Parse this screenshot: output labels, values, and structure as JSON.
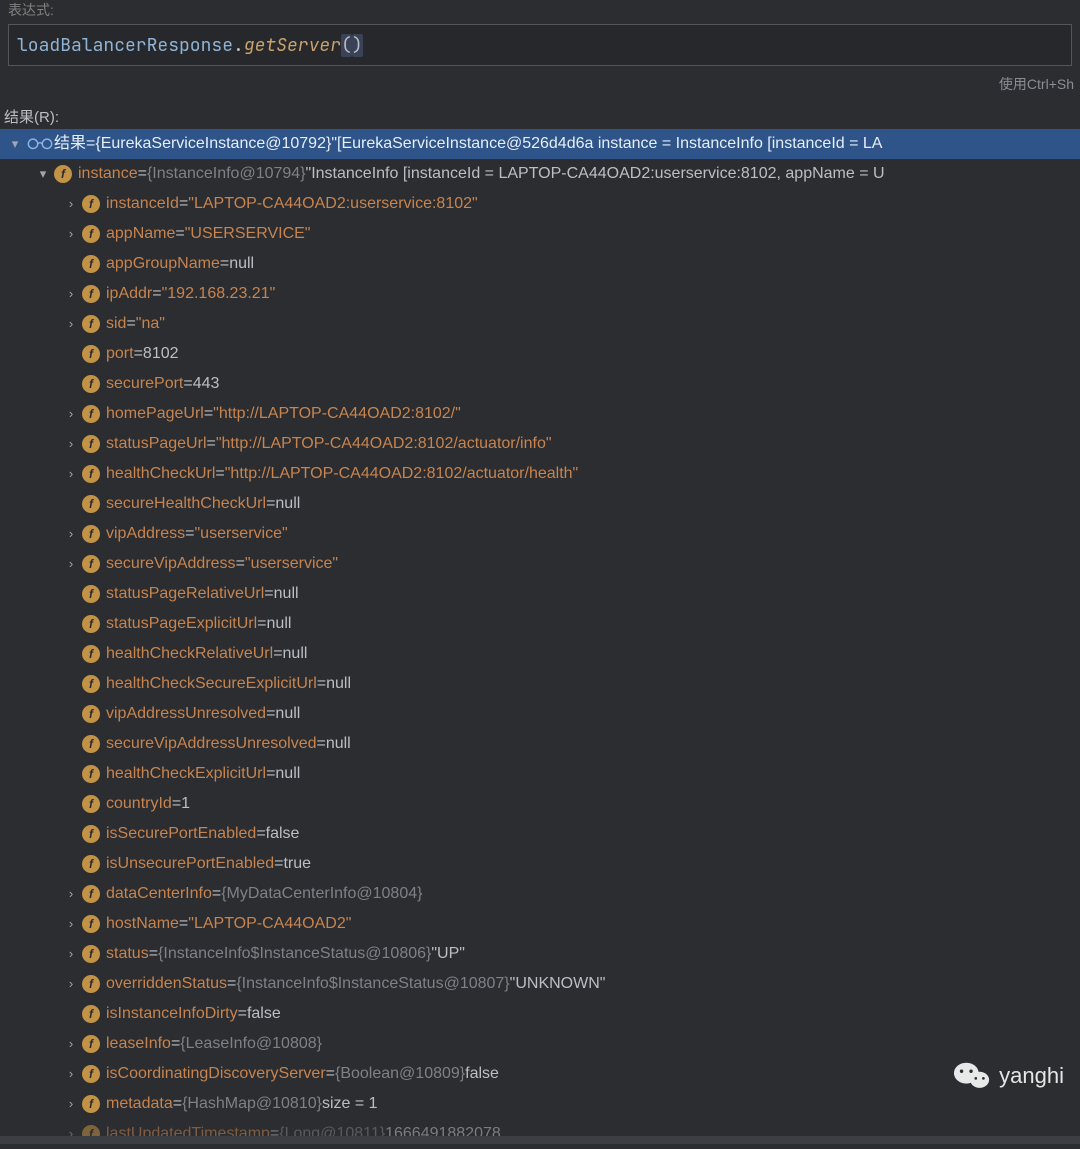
{
  "topLabel": "表达式:",
  "expression": {
    "var": "loadBalancerResponse",
    "dot": ".",
    "method": "getServer",
    "lp": "(",
    "rp": ")"
  },
  "hint": "使用Ctrl+Sh",
  "resultsLabel": "结果(R):",
  "root": {
    "label": "结果",
    "eq": " = ",
    "type": "{EurekaServiceInstance@10792}",
    "desc": " \"[EurekaServiceInstance@526d4d6a instance = InstanceInfo [instanceId = LA"
  },
  "instance": {
    "name": "instance",
    "eq": " = ",
    "type": "{InstanceInfo@10794}",
    "desc": " \"InstanceInfo [instanceId = LAPTOP-CA44OAD2:userservice:8102, appName = U"
  },
  "fields": [
    {
      "arrow": true,
      "name": "instanceId",
      "eq": " = ",
      "value": "\"LAPTOP-CA44OAD2:userservice:8102\"",
      "cls": "str"
    },
    {
      "arrow": true,
      "name": "appName",
      "eq": " = ",
      "value": "\"USERSERVICE\"",
      "cls": "str"
    },
    {
      "arrow": false,
      "name": "appGroupName",
      "eq": " = ",
      "value": "null",
      "cls": "val"
    },
    {
      "arrow": true,
      "name": "ipAddr",
      "eq": " = ",
      "value": "\"192.168.23.21\"",
      "cls": "str"
    },
    {
      "arrow": true,
      "name": "sid",
      "eq": " = ",
      "value": "\"na\"",
      "cls": "str"
    },
    {
      "arrow": false,
      "name": "port",
      "eq": " = ",
      "value": "8102",
      "cls": "val"
    },
    {
      "arrow": false,
      "name": "securePort",
      "eq": " = ",
      "value": "443",
      "cls": "val"
    },
    {
      "arrow": true,
      "name": "homePageUrl",
      "eq": " = ",
      "value": "\"http://LAPTOP-CA44OAD2:8102/\"",
      "cls": "str"
    },
    {
      "arrow": true,
      "name": "statusPageUrl",
      "eq": " = ",
      "value": "\"http://LAPTOP-CA44OAD2:8102/actuator/info\"",
      "cls": "str"
    },
    {
      "arrow": true,
      "name": "healthCheckUrl",
      "eq": " = ",
      "value": "\"http://LAPTOP-CA44OAD2:8102/actuator/health\"",
      "cls": "str"
    },
    {
      "arrow": false,
      "name": "secureHealthCheckUrl",
      "eq": " = ",
      "value": "null",
      "cls": "val"
    },
    {
      "arrow": true,
      "name": "vipAddress",
      "eq": " = ",
      "value": "\"userservice\"",
      "cls": "str"
    },
    {
      "arrow": true,
      "name": "secureVipAddress",
      "eq": " = ",
      "value": "\"userservice\"",
      "cls": "str"
    },
    {
      "arrow": false,
      "name": "statusPageRelativeUrl",
      "eq": " = ",
      "value": "null",
      "cls": "val"
    },
    {
      "arrow": false,
      "name": "statusPageExplicitUrl",
      "eq": " = ",
      "value": "null",
      "cls": "val"
    },
    {
      "arrow": false,
      "name": "healthCheckRelativeUrl",
      "eq": " = ",
      "value": "null",
      "cls": "val"
    },
    {
      "arrow": false,
      "name": "healthCheckSecureExplicitUrl",
      "eq": " = ",
      "value": "null",
      "cls": "val"
    },
    {
      "arrow": false,
      "name": "vipAddressUnresolved",
      "eq": " = ",
      "value": "null",
      "cls": "val"
    },
    {
      "arrow": false,
      "name": "secureVipAddressUnresolved",
      "eq": " = ",
      "value": "null",
      "cls": "val"
    },
    {
      "arrow": false,
      "name": "healthCheckExplicitUrl",
      "eq": " = ",
      "value": "null",
      "cls": "val"
    },
    {
      "arrow": false,
      "name": "countryId",
      "eq": " = ",
      "value": "1",
      "cls": "val"
    },
    {
      "arrow": false,
      "name": "isSecurePortEnabled",
      "eq": " = ",
      "value": "false",
      "cls": "val"
    },
    {
      "arrow": false,
      "name": "isUnsecurePortEnabled",
      "eq": " = ",
      "value": "true",
      "cls": "val"
    },
    {
      "arrow": true,
      "name": "dataCenterInfo",
      "eq": " = ",
      "dimval": "{MyDataCenterInfo@10804}",
      "value": "",
      "cls": "val"
    },
    {
      "arrow": true,
      "name": "hostName",
      "eq": " = ",
      "value": "\"LAPTOP-CA44OAD2\"",
      "cls": "str"
    },
    {
      "arrow": true,
      "name": "status",
      "eq": " = ",
      "dimval": "{InstanceInfo$InstanceStatus@10806}",
      "value": " \"UP\"",
      "cls": "val"
    },
    {
      "arrow": true,
      "name": "overriddenStatus",
      "eq": " = ",
      "dimval": "{InstanceInfo$InstanceStatus@10807}",
      "value": " \"UNKNOWN\"",
      "cls": "val"
    },
    {
      "arrow": false,
      "name": "isInstanceInfoDirty",
      "eq": " = ",
      "value": "false",
      "cls": "val"
    },
    {
      "arrow": true,
      "name": "leaseInfo",
      "eq": " = ",
      "dimval": "{LeaseInfo@10808}",
      "value": "",
      "cls": "val"
    },
    {
      "arrow": true,
      "name": "isCoordinatingDiscoveryServer",
      "eq": " = ",
      "dimval": "{Boolean@10809}",
      "value": " false",
      "cls": "val"
    },
    {
      "arrow": true,
      "name": "metadata",
      "eq": " = ",
      "dimval": "{HashMap@10810}",
      "value": "  size = 1",
      "cls": "val"
    },
    {
      "arrow": true,
      "name": "lastUpdatedTimestamp",
      "eq": " = ",
      "dimval": "{Long@10811}",
      "value": " 1666491882078",
      "cls": "val",
      "cut": true
    }
  ],
  "watermark": "yanghi"
}
